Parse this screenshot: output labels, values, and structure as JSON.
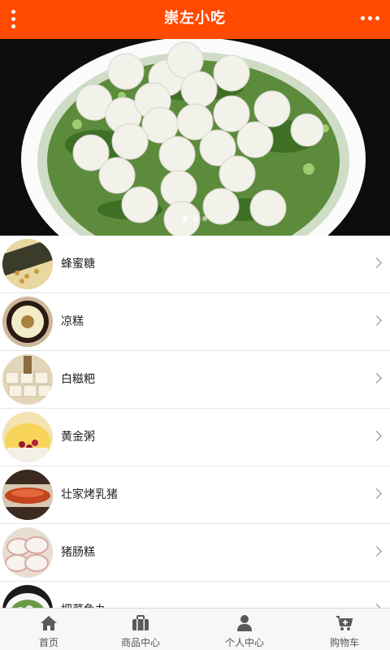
{
  "header": {
    "title": "崇左小吃"
  },
  "banner": {
    "slide_count": 3,
    "active_slide": 1
  },
  "products": [
    {
      "name": "蜂蜜糖"
    },
    {
      "name": "凉糕"
    },
    {
      "name": "白糍粑"
    },
    {
      "name": "黄金粥"
    },
    {
      "name": "壮家烤乳猪"
    },
    {
      "name": "猪肠糕"
    },
    {
      "name": "把荽鱼丸"
    }
  ],
  "tabs": [
    {
      "label": "首页",
      "icon": "home-icon"
    },
    {
      "label": "商品中心",
      "icon": "briefcase-icon"
    },
    {
      "label": "个人中心",
      "icon": "user-icon"
    },
    {
      "label": "购物车",
      "icon": "cart-icon"
    }
  ],
  "colors": {
    "header_bg": "#ff4a00",
    "tabbar_bg": "#f7f7f7",
    "divider": "#e6e6e6"
  }
}
